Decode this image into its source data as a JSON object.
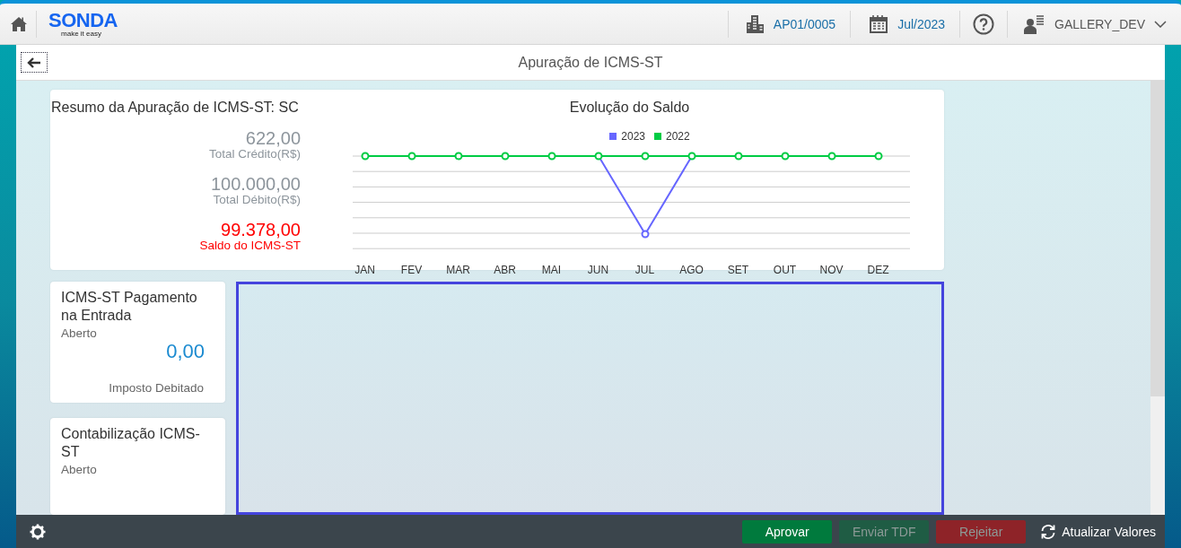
{
  "header": {
    "logo": "SONDA",
    "tagline": "make it easy",
    "company": "AP01/0005",
    "period": "Jul/2023",
    "user": "GALLERY_DEV"
  },
  "page": {
    "title": "Apuração de ICMS-ST"
  },
  "summary": {
    "title": "Resumo da Apuração de ICMS-ST: SC",
    "figures": [
      {
        "value": "622,00",
        "label": "Total Crédito(R$)",
        "kind": "neutral"
      },
      {
        "value": "100.000,00",
        "label": "Total Débito(R$)",
        "kind": "neutral"
      },
      {
        "value": "99.378,00",
        "label": "Saldo do ICMS-ST",
        "kind": "negative"
      }
    ]
  },
  "chart": {
    "title": "Evolução do Saldo",
    "legend": [
      {
        "label": "2023",
        "color": "#6666ff"
      },
      {
        "label": "2022",
        "color": "#00cc44"
      }
    ],
    "months": [
      "JAN",
      "FEV",
      "MAR",
      "ABR",
      "MAI",
      "JUN",
      "JUL",
      "AGO",
      "SET",
      "OUT",
      "NOV",
      "DEZ"
    ]
  },
  "tiles": [
    {
      "title": "ICMS-ST Pagamento na Entrada",
      "status": "Aberto",
      "value": "0,00",
      "caption": "Imposto Debitado"
    },
    {
      "title": "Contabilização ICMS-ST",
      "status": "Aberto"
    }
  ],
  "footer": {
    "buttons": [
      {
        "label": "Aprovar",
        "kind": "approve",
        "disabled": false
      },
      {
        "label": "Enviar TDF",
        "kind": "send",
        "disabled": true
      },
      {
        "label": "Rejeitar",
        "kind": "reject",
        "disabled": true
      }
    ],
    "refresh": "Atualizar Valores"
  }
}
